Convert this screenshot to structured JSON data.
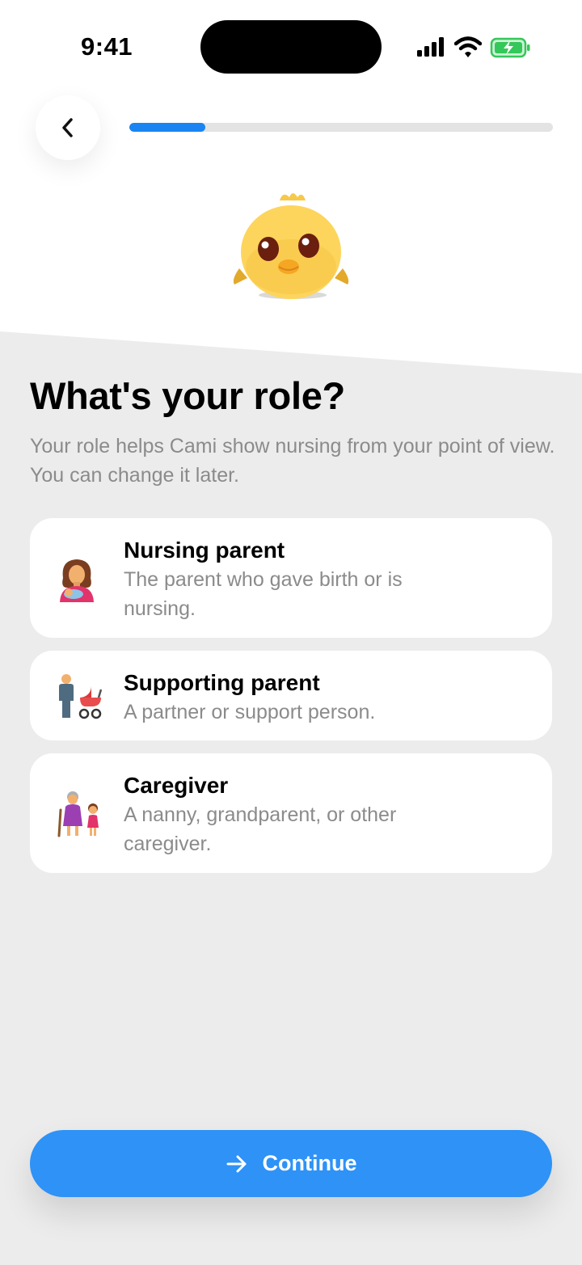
{
  "status_bar": {
    "time": "9:41"
  },
  "onboarding": {
    "progress": 0.18
  },
  "main": {
    "title": "What's your role?",
    "subtitle": "Your role helps Cami show nursing from your point of view. You can change it later."
  },
  "options": [
    {
      "title": "Nursing parent",
      "description": "The parent who gave birth or is nursing.",
      "icon": "breastfeeding-icon"
    },
    {
      "title": "Supporting parent",
      "description": "A partner or support person.",
      "icon": "person-with-stroller-icon"
    },
    {
      "title": "Caregiver",
      "description": "A nanny, grandparent, or other caregiver.",
      "icon": "grandparent-with-child-icon"
    }
  ],
  "footer": {
    "continue_label": "Continue"
  },
  "colors": {
    "accent": "#2E92F7",
    "progress": "#1A84F2",
    "background": "#ECECEC",
    "battery": "#34C759"
  }
}
